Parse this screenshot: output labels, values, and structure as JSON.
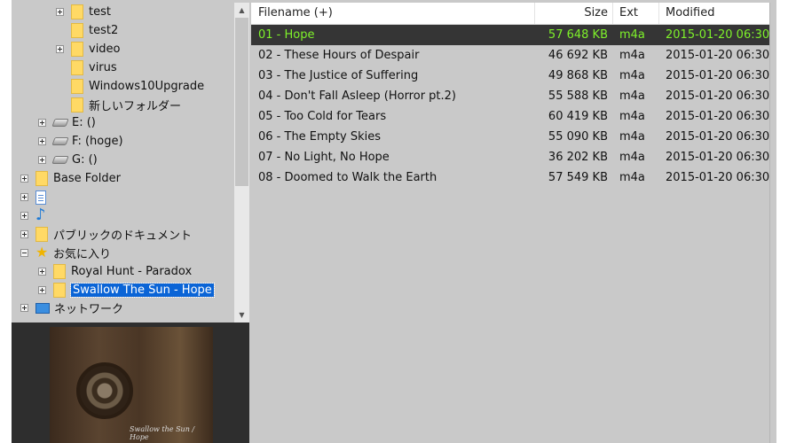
{
  "tree": {
    "items": [
      {
        "label": "test",
        "depth": 3,
        "expander": "plus",
        "icon": "folder"
      },
      {
        "label": "test2",
        "depth": 3,
        "expander": "none",
        "icon": "folder"
      },
      {
        "label": "video",
        "depth": 3,
        "expander": "plus",
        "icon": "folder"
      },
      {
        "label": "virus",
        "depth": 3,
        "expander": "none",
        "icon": "folder"
      },
      {
        "label": "Windows10Upgrade",
        "depth": 3,
        "expander": "none",
        "icon": "folder"
      },
      {
        "label": "新しいフォルダー",
        "depth": 3,
        "expander": "none",
        "icon": "folder"
      },
      {
        "label": "E: ()",
        "depth": 1,
        "expander": "plus",
        "icon": "drive"
      },
      {
        "label": "F: (hoge)",
        "depth": 1,
        "expander": "plus",
        "icon": "drive"
      },
      {
        "label": "G: ()",
        "depth": 1,
        "expander": "plus",
        "icon": "drive"
      },
      {
        "label": "Base Folder",
        "depth": 0,
        "expander": "plus",
        "icon": "folder"
      },
      {
        "label": "",
        "depth": 0,
        "expander": "plus",
        "icon": "document"
      },
      {
        "label": "",
        "depth": 0,
        "expander": "plus",
        "icon": "music-note"
      },
      {
        "label": "パブリックのドキュメント",
        "depth": 0,
        "expander": "plus",
        "icon": "folder"
      },
      {
        "label": "お気に入り",
        "depth": 0,
        "expander": "minus",
        "icon": "star"
      },
      {
        "label": "Royal Hunt - Paradox",
        "depth": 1,
        "expander": "plus",
        "icon": "folder"
      },
      {
        "label": "Swallow The Sun - Hope",
        "depth": 1,
        "expander": "plus",
        "icon": "folder",
        "selected": true
      },
      {
        "label": "ネットワーク",
        "depth": 0,
        "expander": "plus",
        "icon": "network"
      }
    ]
  },
  "scrollbar": {
    "up": "▲",
    "down": "▼"
  },
  "album_art": {
    "caption": "Swallow the Sun / Hope"
  },
  "list": {
    "columns": {
      "filename": "Filename (+)",
      "size": "Size",
      "ext": "Ext",
      "modified": "Modified"
    },
    "rows": [
      {
        "name": "01 - Hope",
        "size": "57 648 KB",
        "ext": "m4a",
        "modified": "2015-01-20 06:30",
        "selected": true
      },
      {
        "name": "02 - These Hours of Despair",
        "size": "46 692 KB",
        "ext": "m4a",
        "modified": "2015-01-20 06:30"
      },
      {
        "name": "03 - The Justice of Suffering",
        "size": "49 868 KB",
        "ext": "m4a",
        "modified": "2015-01-20 06:30"
      },
      {
        "name": "04 - Don't Fall Asleep (Horror pt.2)",
        "size": "55 588 KB",
        "ext": "m4a",
        "modified": "2015-01-20 06:30"
      },
      {
        "name": "05 - Too Cold for Tears",
        "size": "60 419 KB",
        "ext": "m4a",
        "modified": "2015-01-20 06:30"
      },
      {
        "name": "06 - The Empty Skies",
        "size": "55 090 KB",
        "ext": "m4a",
        "modified": "2015-01-20 06:30"
      },
      {
        "name": "07 - No Light, No Hope",
        "size": "36 202 KB",
        "ext": "m4a",
        "modified": "2015-01-20 06:30"
      },
      {
        "name": "08 - Doomed to Walk the Earth",
        "size": "57 549 KB",
        "ext": "m4a",
        "modified": "2015-01-20 06:30"
      }
    ]
  },
  "colors": {
    "selected_row_bg": "#353535",
    "selected_row_text": "#7ef12a",
    "tree_selection": "#0a64d6",
    "pane_bg": "#c9c9c9"
  }
}
